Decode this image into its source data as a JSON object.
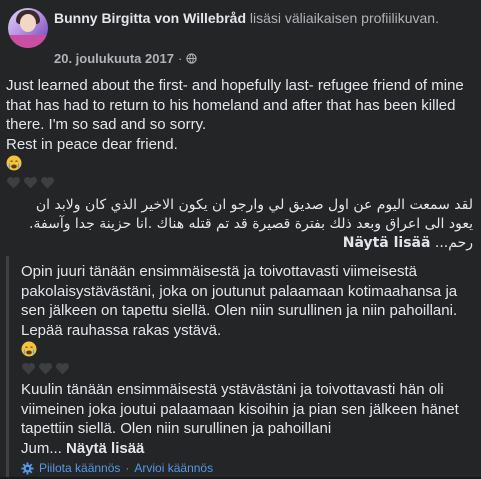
{
  "header": {
    "author": "Bunny Birgitta von Willebråd",
    "action": "lisäsi väliaikaisen profiilikuvan.",
    "date": "20. joulukuuta 2017",
    "separator": "·",
    "privacy_icon": "globe-icon"
  },
  "post": {
    "lines": [
      "Just learned about the first- and hopefully last- refugee friend of mine",
      "that has had to return to his homeland and after that has been killed",
      "there. I'm so sad and so sorry.",
      "Rest in peace dear friend."
    ],
    "emoji_icon": "crying-face-icon",
    "hearts_icon": "black-heart-icon",
    "arabic_line1": "لقد سمعت اليوم عن اول صديق لي وارجو ان يكون الاخير الذي كان ولابد ان",
    "arabic_line2": "يعود الى اعراق وبعد ذلك بفترة قصيرة قد تم قتله هناك .انا حزينة جدا وآسفة.",
    "arabic_line3": "رحم...",
    "see_more": "Näytä lisää"
  },
  "translation": {
    "para1_lines": [
      "Opin juuri tänään ensimmäisestä ja toivottavasti viimeisestä",
      "pakolaisystävästäni, joka on joutunut palaamaan kotimaahansa ja",
      "sen jälkeen on tapettu siellä. Olen niin surullinen ja niin pahoillani.",
      "Lepää rauhassa rakas ystävä."
    ],
    "para2_lines": [
      "Kuulin tänään ensimmäisestä ystävästäni ja toivottavasti hän oli",
      "viimeinen joka joutui palaamaan kisoihin ja pian sen jälkeen hänet",
      "tapettiin siellä. Olen niin surullinen ja pahoillani"
    ],
    "para2_tail": "Jum...",
    "see_more": "Näytä lisää",
    "hide_translation": "Piilota käännös",
    "rate_translation": "Arvioi käännös",
    "dot": "·",
    "settings_icon": "gear-icon"
  },
  "colors": {
    "background": "#242526",
    "text": "#e4e6eb",
    "secondary": "#b0b3b8",
    "link": "#5599e6"
  }
}
